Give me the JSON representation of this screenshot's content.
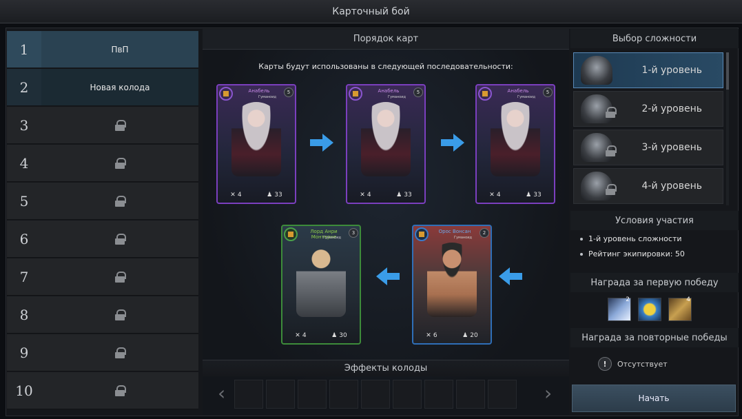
{
  "window": {
    "title": "Карточный бой"
  },
  "decks": [
    {
      "num": "1",
      "label": "ПвП",
      "state": "selected"
    },
    {
      "num": "2",
      "label": "Новая колода",
      "state": "unlocked"
    },
    {
      "num": "3",
      "label": "",
      "state": "locked"
    },
    {
      "num": "4",
      "label": "",
      "state": "locked"
    },
    {
      "num": "5",
      "label": "",
      "state": "locked"
    },
    {
      "num": "6",
      "label": "",
      "state": "locked"
    },
    {
      "num": "7",
      "label": "",
      "state": "locked"
    },
    {
      "num": "8",
      "label": "",
      "state": "locked"
    },
    {
      "num": "9",
      "label": "",
      "state": "locked"
    },
    {
      "num": "10",
      "label": "",
      "state": "locked"
    }
  ],
  "order": {
    "title": "Порядок карт",
    "note": "Карты будут использованы в следующей последовательности:",
    "cards": [
      {
        "name": "Анабель",
        "race": "Гуманоид",
        "level": "5",
        "attack": "4",
        "health": "33",
        "rarity": "purple"
      },
      {
        "name": "Анабель",
        "race": "Гуманоид",
        "level": "5",
        "attack": "4",
        "health": "33",
        "rarity": "purple"
      },
      {
        "name": "Анабель",
        "race": "Гуманоид",
        "level": "5",
        "attack": "4",
        "health": "33",
        "rarity": "purple"
      },
      {
        "name": "Орос Вонсан",
        "race": "Гуманоид",
        "level": "2",
        "attack": "6",
        "health": "20",
        "rarity": "blue"
      },
      {
        "name": "Лорд Анри Монтерне",
        "race": "Гуманоид",
        "level": "3",
        "attack": "4",
        "health": "30",
        "rarity": "green"
      }
    ]
  },
  "effects": {
    "title": "Эффекты колоды"
  },
  "difficulty": {
    "title": "Выбор сложности",
    "levels": [
      {
        "label": "1-й уровень",
        "locked": false
      },
      {
        "label": "2-й уровень",
        "locked": true
      },
      {
        "label": "3-й уровень",
        "locked": true
      },
      {
        "label": "4-й уровень",
        "locked": true
      }
    ]
  },
  "conditions": {
    "title": "Условия участия",
    "items": [
      "1-й уровень сложности",
      "Рейтинг экипировки: 50"
    ]
  },
  "first_reward": {
    "title": "Награда за первую победу",
    "items": [
      {
        "icon": "feather-icon",
        "count": "2"
      },
      {
        "icon": "crystal-icon",
        "count": ""
      },
      {
        "icon": "scroll-icon",
        "count": "4"
      }
    ]
  },
  "repeat_reward": {
    "title": "Награда за повторные победы",
    "value": "Отсутствует"
  },
  "start_label": "Начать",
  "colors": {
    "selected_deck": "#2f4a5c",
    "accent_blue": "#3a9ce8"
  }
}
